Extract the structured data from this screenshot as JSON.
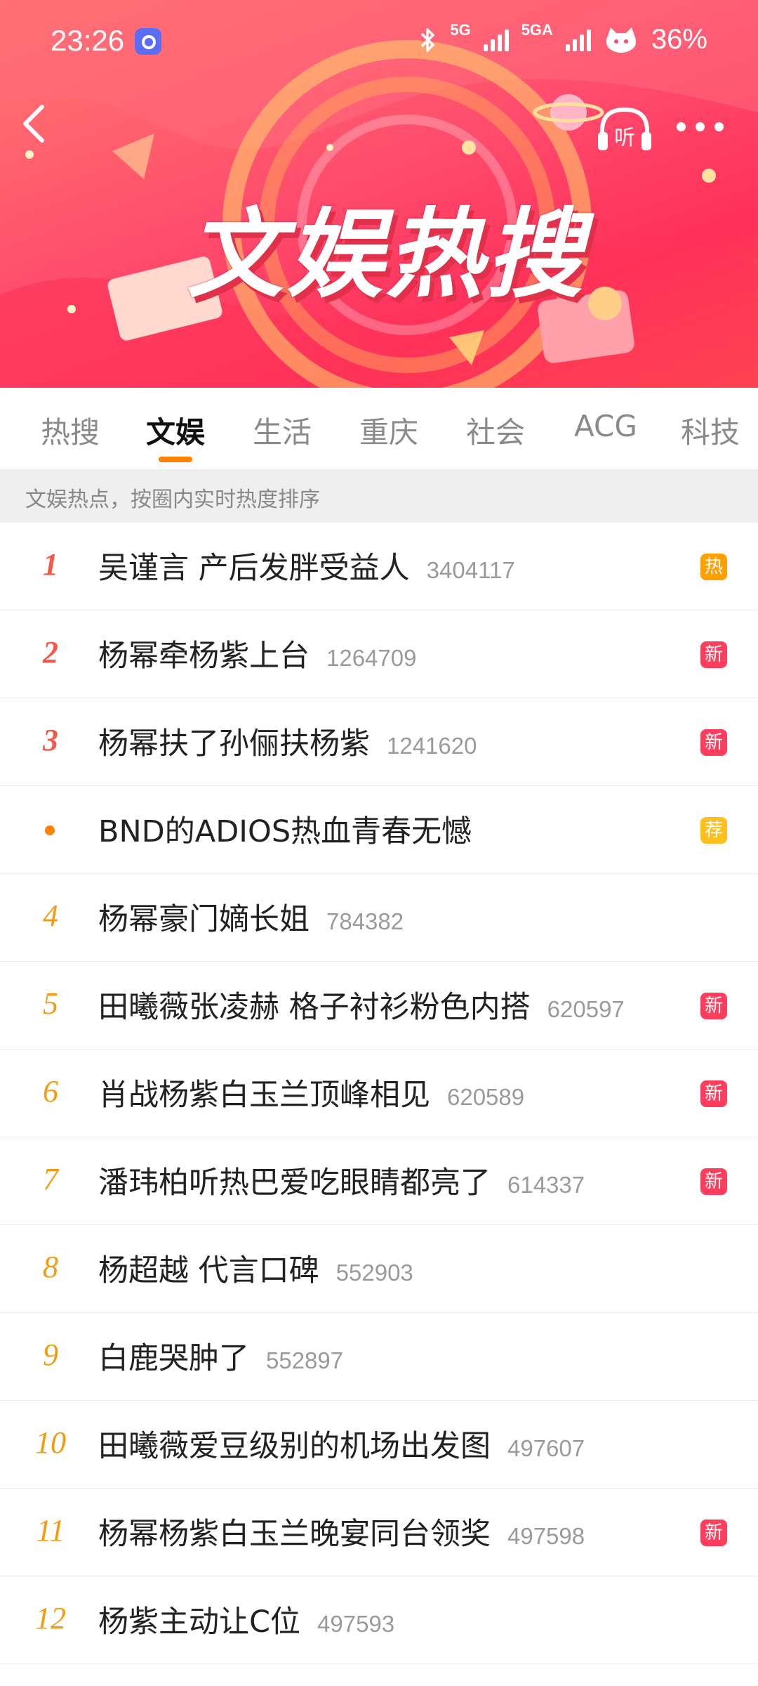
{
  "status_bar": {
    "time": "23:26",
    "network1": "5G",
    "network2": "5GA",
    "battery": "36%"
  },
  "banner": {
    "title": "文娱热搜",
    "listen_label": "听"
  },
  "tabs": [
    {
      "label": "热搜"
    },
    {
      "label": "文娱"
    },
    {
      "label": "生活"
    },
    {
      "label": "重庆"
    },
    {
      "label": "社会"
    },
    {
      "label": "ACG"
    },
    {
      "label": "科技"
    }
  ],
  "active_tab": "文娱",
  "info_text": "文娱热点，按圈内实时热度排序",
  "items": [
    {
      "rank": "1",
      "title": "吴谨言 产后发胖受益人",
      "count": "3404117",
      "badge": "热"
    },
    {
      "rank": "2",
      "title": "杨幂牵杨紫上台",
      "count": "1264709",
      "badge": "新"
    },
    {
      "rank": "3",
      "title": "杨幂扶了孙俪扶杨紫",
      "count": "1241620",
      "badge": "新"
    },
    {
      "rank": "",
      "title": "BND的ADIOS热血青春无憾",
      "count": "",
      "badge": "荐"
    },
    {
      "rank": "4",
      "title": "杨幂豪门嫡长姐",
      "count": "784382",
      "badge": ""
    },
    {
      "rank": "5",
      "title": "田曦薇张凌赫 格子衬衫粉色内搭",
      "count": "620597",
      "badge": "新"
    },
    {
      "rank": "6",
      "title": "肖战杨紫白玉兰顶峰相见",
      "count": "620589",
      "badge": "新"
    },
    {
      "rank": "7",
      "title": "潘玮柏听热巴爱吃眼睛都亮了",
      "count": "614337",
      "badge": "新"
    },
    {
      "rank": "8",
      "title": "杨超越 代言口碑",
      "count": "552903",
      "badge": ""
    },
    {
      "rank": "9",
      "title": "白鹿哭肿了",
      "count": "552897",
      "badge": ""
    },
    {
      "rank": "10",
      "title": "田曦薇爱豆级别的机场出发图",
      "count": "497607",
      "badge": ""
    },
    {
      "rank": "11",
      "title": "杨幂杨紫白玉兰晚宴同台领奖",
      "count": "497598",
      "badge": "新"
    },
    {
      "rank": "12",
      "title": "杨紫主动让C位",
      "count": "497593",
      "badge": ""
    }
  ],
  "colors": {
    "accent": "#ff8200",
    "rank_top": "#f25a49",
    "rank_other": "#f39c12",
    "badge_hot": "#ffa000",
    "badge_new": "#ff3e5e",
    "badge_rec": "#ffbf1f"
  },
  "icons": {
    "back": "chevron-left-icon",
    "listen": "headphones-icon",
    "more": "more-dots-icon",
    "bluetooth": "bluetooth-icon"
  }
}
